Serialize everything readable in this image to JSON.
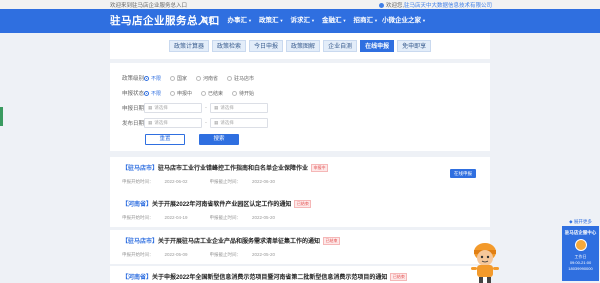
{
  "topbar": {
    "welcome": "欢迎来到驻马店企业服务总入口",
    "user_prefix": "欢迎您,",
    "user_name": "驻马店天中大数据信息技术有限公司"
  },
  "header": {
    "logo": "驻马店企业服务总入口",
    "nav": [
      {
        "label": "首页",
        "caret": ""
      },
      {
        "label": "办事汇",
        "caret": "▼"
      },
      {
        "label": "政策汇",
        "caret": "▼"
      },
      {
        "label": "诉求汇",
        "caret": "▼"
      },
      {
        "label": "金融汇",
        "caret": "▼"
      },
      {
        "label": "招商汇",
        "caret": "▼"
      },
      {
        "label": "小微企业之家",
        "caret": "▼"
      }
    ]
  },
  "tabs": [
    {
      "label": "政策计算器",
      "active": false
    },
    {
      "label": "政策检索",
      "active": false
    },
    {
      "label": "今日申报",
      "active": false
    },
    {
      "label": "政策图解",
      "active": false
    },
    {
      "label": "企业自测",
      "active": false
    },
    {
      "label": "在线申报",
      "active": true
    },
    {
      "label": "免申即享",
      "active": false
    }
  ],
  "filter": {
    "policy_level": {
      "label": "政策级别",
      "options": [
        {
          "label": "不限",
          "selected": true
        },
        {
          "label": "国家",
          "selected": false
        },
        {
          "label": "河南省",
          "selected": false
        },
        {
          "label": "驻马店市",
          "selected": false
        }
      ]
    },
    "apply_status": {
      "label": "申报状态",
      "options": [
        {
          "label": "不限",
          "selected": true
        },
        {
          "label": "申报中",
          "selected": false
        },
        {
          "label": "已结束",
          "selected": false
        },
        {
          "label": "待开始",
          "selected": false
        }
      ]
    },
    "apply_date": {
      "label": "申报日期",
      "start_placeholder": "请选择",
      "end_placeholder": "请选择",
      "separator": "-"
    },
    "publish_date": {
      "label": "发布日期",
      "start_placeholder": "请选择",
      "end_placeholder": "请选择",
      "separator": "-"
    },
    "reset_label": "重置",
    "search_label": "搜索"
  },
  "results": [
    {
      "tag": "【驻马店市】",
      "title": "驻马店市工业行业错峰控工作指南和白名单企业保障作业",
      "status": "申报中",
      "start_label": "申报开始时间：",
      "start": "2022-06-02",
      "end_label": "申报截止时间：",
      "end": "2022-06-30",
      "action": "在线申报"
    },
    {
      "tag": "【河南省】",
      "title": "关于开展2022年河南省软件产业园区认定工作的通知",
      "status": "已结束",
      "start_label": "申报开始时间：",
      "start": "2022-04-19",
      "end_label": "申报截止时间：",
      "end": "2022-05-20",
      "action": ""
    },
    {
      "tag": "【驻马店市】",
      "title": "关于开展驻马店工业企业产品和服务需求清单征集工作的通知",
      "status": "已结束",
      "start_label": "申报开始时间：",
      "start": "2022-05-09",
      "end_label": "申报截止时间：",
      "end": "2022-05-20",
      "action": ""
    },
    {
      "tag": "【河南省】",
      "title": "关于申报2022年全国新型信息消费示范项目暨河南省第二批新型信息消费示范项目的通知",
      "status": "已结束",
      "start_label": "",
      "start": "",
      "end_label": "",
      "end": "",
      "action": ""
    }
  ],
  "side_widget": {
    "head": "◆ 展开更多",
    "title": "驻马店企服中心",
    "lines": [
      "工作日",
      "09:00-21:00",
      "18039990000"
    ]
  },
  "colors": {
    "primary": "#2f6fe0",
    "badge_red": "#e35050",
    "page_bg": "#eef1f6"
  }
}
